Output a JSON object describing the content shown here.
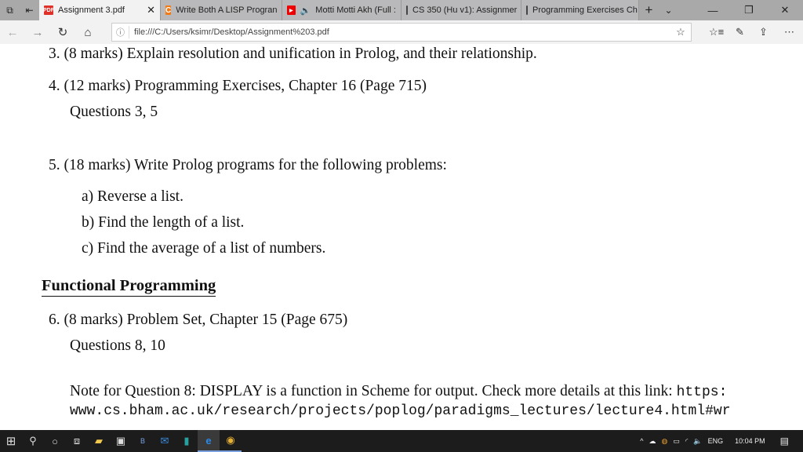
{
  "browser": {
    "tabs": [
      {
        "label": "Assignment 3.pdf",
        "icon": "pdf-icon",
        "active": true
      },
      {
        "label": "Write Both A LISP Progran",
        "icon": "chegg-icon"
      },
      {
        "label": "Motti Motti Akh (Full :",
        "icon": "youtube-icon"
      },
      {
        "label": "CS 350 (Hu v1): Assignmer",
        "icon": "page-icon"
      },
      {
        "label": "Programming Exercises Ch",
        "icon": "page-icon"
      }
    ],
    "url": "file:///C:/Users/ksimr/Desktop/Assignment%203.pdf"
  },
  "document": {
    "q3": "3.  (8 marks) Explain resolution and unification in Prolog, and their relationship.",
    "q4": "4.  (12 marks) Programming Exercises, Chapter 16 (Page 715)",
    "q4_sub": "Questions 3, 5",
    "q5": "5.  (18 marks) Write Prolog programs for the following problems:",
    "q5_items": [
      "a)  Reverse a list.",
      "b)  Find the length of a list.",
      "c)  Find the average of a list of numbers."
    ],
    "section": "Functional Programming",
    "q6": "6.  (8 marks) Problem Set, Chapter 15 (Page 675)",
    "q6_sub": "Questions 8, 10",
    "note": "Note for Question 8: DISPLAY is a function in Scheme for output. Check more details at this link:",
    "note_link1": "https:",
    "note_link2": "www.cs.bham.ac.uk/research/projects/poplog/paradigms_lectures/lecture4.html#wr"
  },
  "taskbar": {
    "lang": "ENG",
    "time": "10:04 PM"
  }
}
